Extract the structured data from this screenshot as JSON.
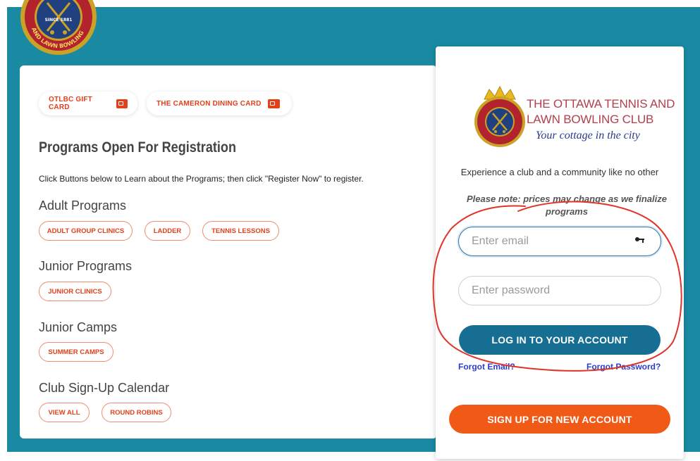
{
  "top_logo": {
    "text_since": "SINCE 1881",
    "ring_text": "AND LAWN BOWLING"
  },
  "cards": {
    "gift_card": "OTLBC GIFT CARD",
    "dining_card": "THE CAMERON DINING CARD"
  },
  "programs": {
    "heading": "Programs Open For Registration",
    "subtext": "Click Buttons below to Learn about the Programs; then click \"Register Now\" to register.",
    "sections": [
      {
        "title": "Adult Programs",
        "buttons": [
          "ADULT GROUP CLINICS",
          "LADDER",
          "TENNIS LESSONS"
        ]
      },
      {
        "title": "Junior Programs",
        "buttons": [
          "JUNIOR CLINICS"
        ]
      },
      {
        "title": "Junior Camps",
        "buttons": [
          "SUMMER CAMPS"
        ]
      },
      {
        "title": "Club Sign-Up Calendar",
        "buttons": [
          "VIEW ALL",
          "ROUND ROBINS"
        ]
      }
    ]
  },
  "login": {
    "logo_line1": "THE OTTAWA TENNIS AND",
    "logo_line2": "LAWN BOWLING CLUB",
    "logo_tagline": "Your cottage in the city",
    "experience": "Experience a club and a community like no other",
    "note": "Please note: prices may change as we finalize programs",
    "email_placeholder": "Enter email",
    "password_placeholder": "Enter password",
    "login_button": "LOG IN TO YOUR ACCOUNT",
    "forgot_email": "Forgot Email?",
    "forgot_password": "Forgot Password?",
    "signup_button": "SIGN UP FOR NEW ACCOUNT"
  },
  "colors": {
    "teal_background": "#1a8aa3",
    "accent_orange": "#e2401a",
    "login_blue": "#176e93",
    "signup_orange": "#f05a16",
    "annotation_red": "#e0332a"
  }
}
